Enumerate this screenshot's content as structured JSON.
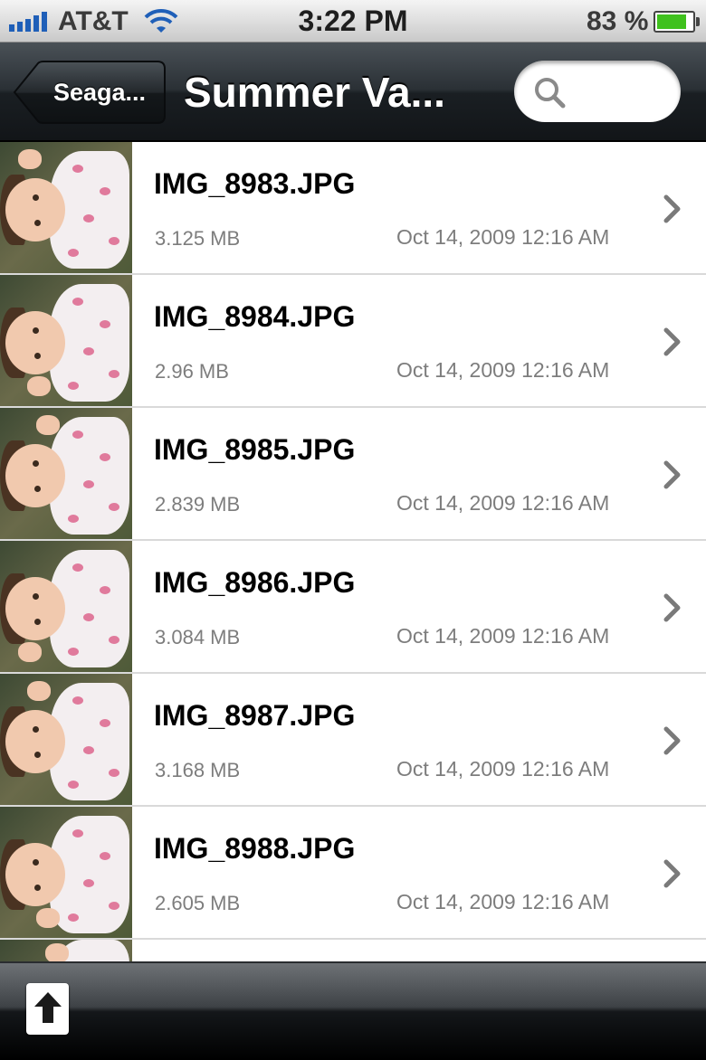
{
  "status_bar": {
    "carrier": "AT&T",
    "time": "3:22 PM",
    "battery_percent": "83 %",
    "battery_level": 0.83,
    "signal_bars": 5,
    "signal_icon": "signal-bars-icon",
    "wifi_icon": "wifi-icon",
    "battery_icon": "battery-icon",
    "battery_color": "#3fc11d"
  },
  "nav_bar": {
    "back_label": "Seaga...",
    "title": "Summer Va...",
    "search_icon": "search-icon",
    "search_value": ""
  },
  "files": [
    {
      "name": "IMG_8983.JPG",
      "size": "3.125 MB",
      "date": "Oct 14, 2009 12:16 AM"
    },
    {
      "name": "IMG_8984.JPG",
      "size": "2.96 MB",
      "date": "Oct 14, 2009 12:16 AM"
    },
    {
      "name": "IMG_8985.JPG",
      "size": "2.839 MB",
      "date": "Oct 14, 2009 12:16 AM"
    },
    {
      "name": "IMG_8986.JPG",
      "size": "3.084 MB",
      "date": "Oct 14, 2009 12:16 AM"
    },
    {
      "name": "IMG_8987.JPG",
      "size": "3.168 MB",
      "date": "Oct 14, 2009 12:16 AM"
    },
    {
      "name": "IMG_8988.JPG",
      "size": "2.605 MB",
      "date": "Oct 14, 2009 12:16 AM"
    }
  ],
  "toolbar": {
    "upload_icon": "upload-arrow-icon"
  },
  "colors": {
    "nav_dark": "#1a1f23",
    "signal_blue": "#1f5fb8",
    "secondary_text": "#7d7d7d"
  }
}
